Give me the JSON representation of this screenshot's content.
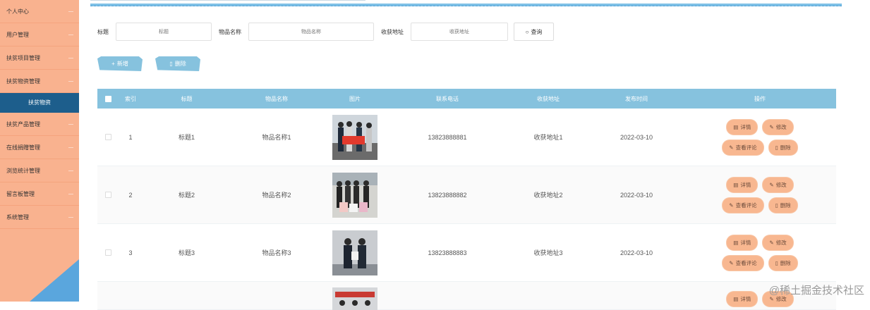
{
  "sidebar": {
    "items": [
      {
        "label": "个人中心"
      },
      {
        "label": "用户管理"
      },
      {
        "label": "扶贫项目管理"
      },
      {
        "label": "扶贫物资管理"
      }
    ],
    "active_sub": "扶贫物资",
    "items_after": [
      {
        "label": "扶贫产品管理"
      },
      {
        "label": "在线捐赠管理"
      },
      {
        "label": "浏览统计管理"
      },
      {
        "label": "留言板管理"
      },
      {
        "label": "系统管理"
      }
    ]
  },
  "search": {
    "title_label": "标题",
    "title_placeholder": "标题",
    "name_label": "物品名称",
    "name_placeholder": "物品名称",
    "addr_label": "收获地址",
    "addr_placeholder": "收获地址",
    "button": "查询"
  },
  "actions": {
    "add": "新增",
    "delete": "删除"
  },
  "table": {
    "headers": [
      "索引",
      "标题",
      "物品名称",
      "图片",
      "联系电话",
      "收获地址",
      "发布时间",
      "操作"
    ],
    "rows": [
      {
        "index": "1",
        "title": "标题1",
        "name": "物品名称1",
        "phone": "13823888881",
        "addr": "收获地址1",
        "date": "2022-03-10"
      },
      {
        "index": "2",
        "title": "标题2",
        "name": "物品名称2",
        "phone": "13823888882",
        "addr": "收获地址2",
        "date": "2022-03-10"
      },
      {
        "index": "3",
        "title": "标题3",
        "name": "物品名称3",
        "phone": "13823888883",
        "addr": "收获地址3",
        "date": "2022-03-10"
      }
    ],
    "ops": {
      "detail": "详情",
      "edit": "修改",
      "review": "查看评论",
      "delete": "删除"
    }
  },
  "watermark": "@稀土掘金技术社区",
  "colors": {
    "sidebar": "#f9b28f",
    "accent": "#86c2de",
    "active": "#1d5e8c",
    "op_button": "#f8b790"
  }
}
